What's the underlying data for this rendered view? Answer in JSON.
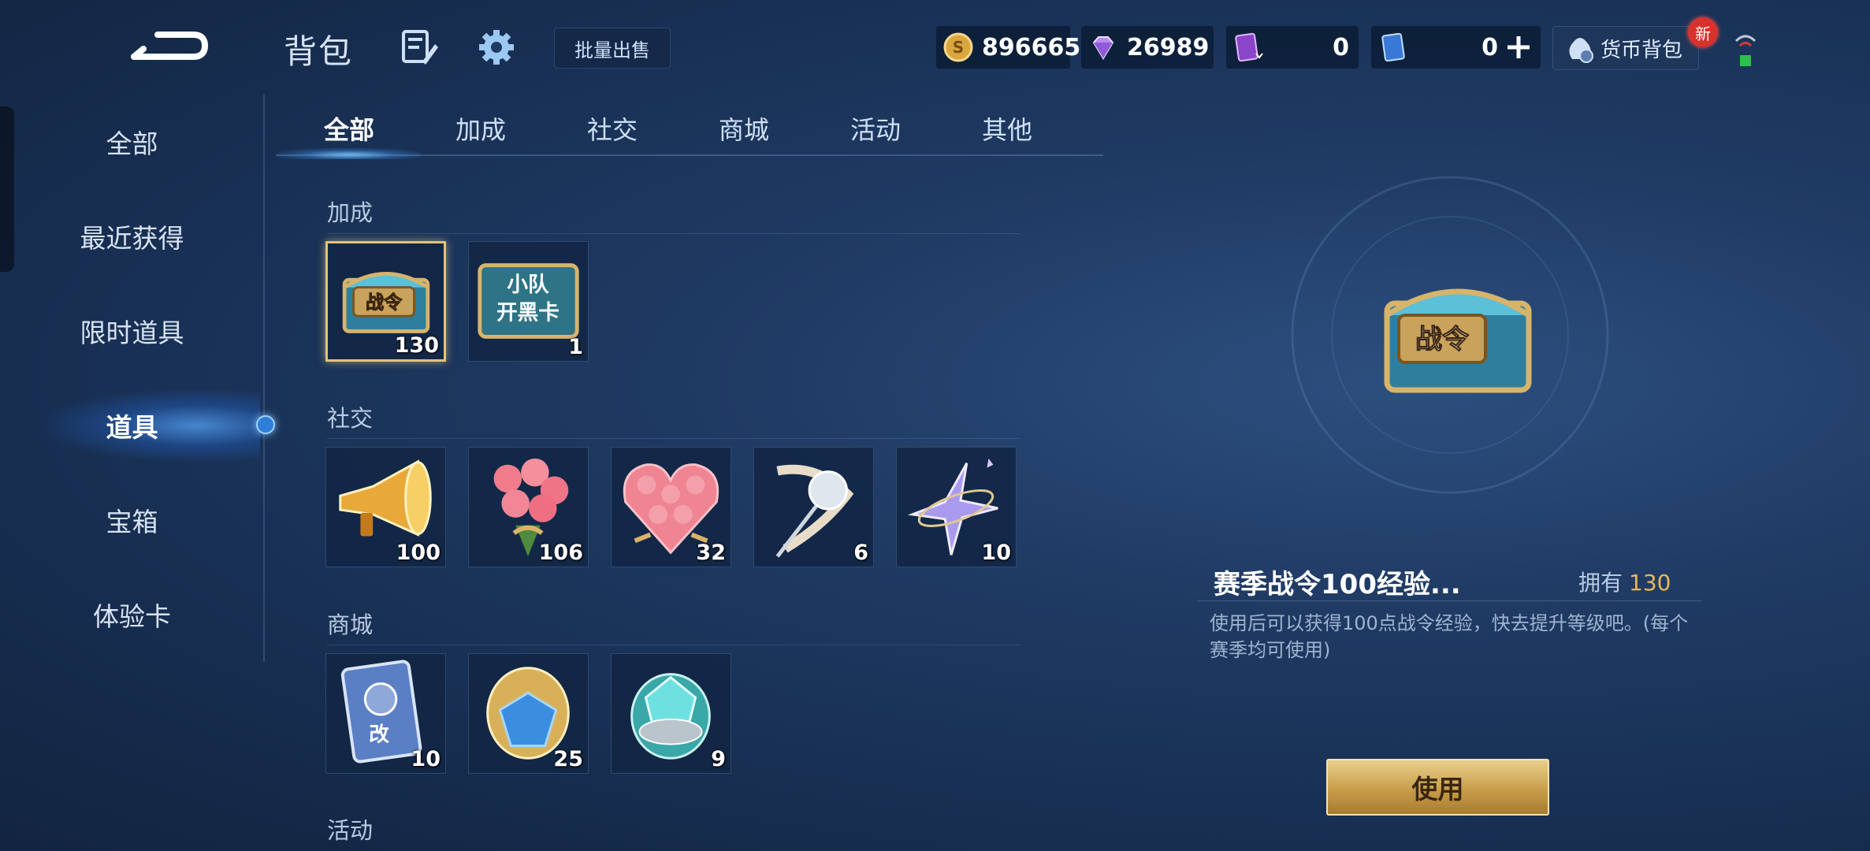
{
  "header": {
    "title": "背包",
    "batch_sell_label": "批量出售",
    "currencies": [
      {
        "icon": "gold-coin-icon",
        "value": "896665"
      },
      {
        "icon": "diamond-icon",
        "value": "26989"
      },
      {
        "icon": "purple-ticket-icon",
        "value": "0"
      },
      {
        "icon": "blue-ticket-icon",
        "value": "0"
      }
    ],
    "wallet_label": "货币背包",
    "new_badge": "新"
  },
  "sidebar": {
    "items": [
      {
        "label": "全部"
      },
      {
        "label": "最近获得"
      },
      {
        "label": "限时道具"
      },
      {
        "label": "道具",
        "active": true
      },
      {
        "label": "宝箱"
      },
      {
        "label": "体验卡"
      }
    ]
  },
  "tabs": [
    {
      "label": "全部",
      "active": true
    },
    {
      "label": "加成"
    },
    {
      "label": "社交"
    },
    {
      "label": "商城"
    },
    {
      "label": "活动"
    },
    {
      "label": "其他"
    }
  ],
  "sections": [
    {
      "label": "加成",
      "items": [
        {
          "icon": "battle-pass-chest-icon",
          "text": "战令",
          "count": "130",
          "selected": true
        },
        {
          "icon": "squad-card-icon",
          "text": "小队开黑卡",
          "count": "1"
        }
      ]
    },
    {
      "label": "社交",
      "items": [
        {
          "icon": "megaphone-icon",
          "count": "100"
        },
        {
          "icon": "rose-bouquet-icon",
          "count": "106"
        },
        {
          "icon": "rose-heart-icon",
          "count": "32"
        },
        {
          "icon": "silver-rose-icon",
          "count": "6"
        },
        {
          "icon": "star-icon",
          "count": "10"
        }
      ]
    },
    {
      "label": "商城",
      "items": [
        {
          "icon": "rename-card-icon",
          "text": "改",
          "count": "10"
        },
        {
          "icon": "gold-crystal-icon",
          "count": "25"
        },
        {
          "icon": "teal-crystal-icon",
          "count": "9"
        }
      ]
    },
    {
      "label": "活动",
      "items": []
    }
  ],
  "detail": {
    "name": "赛季战令100经验...",
    "own_label": "拥有",
    "own_count": "130",
    "description": "使用后可以获得100点战令经验，快去提升等级吧。(每个赛季均可使用)",
    "use_button": "使用",
    "preview_text": "战令"
  },
  "colors": {
    "accent_gold": "#e7b85a",
    "selected_border": "#e4c27a",
    "badge_red": "#d8322c"
  }
}
